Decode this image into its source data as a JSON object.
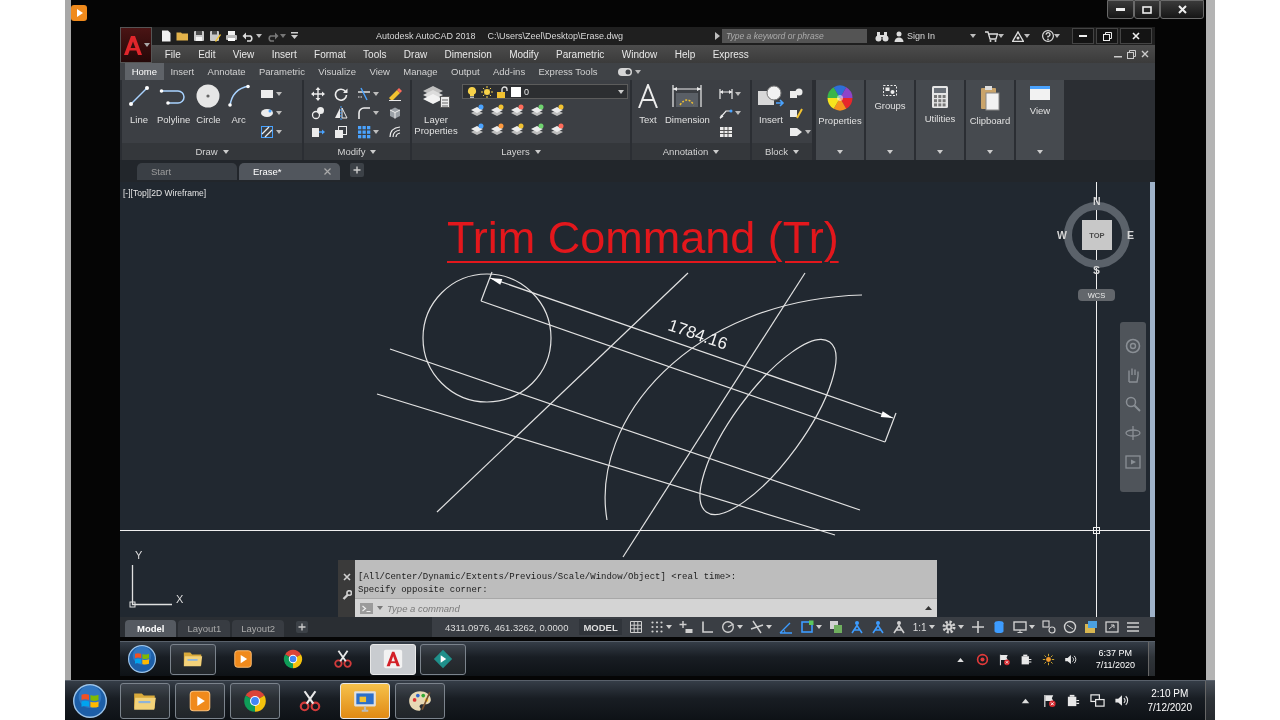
{
  "autocad": {
    "title": {
      "app": "Autodesk AutoCAD 2018",
      "file": "C:\\Users\\Zeel\\Desktop\\Erase.dwg"
    },
    "search": {
      "placeholder": "Type a keyword or phrase"
    },
    "sign_in": "Sign In",
    "menu": [
      "File",
      "Edit",
      "View",
      "Insert",
      "Format",
      "Tools",
      "Draw",
      "Dimension",
      "Modify",
      "Parametric",
      "Window",
      "Help",
      "Express"
    ],
    "ribbon_tabs": [
      {
        "label": "Home",
        "selected": true
      },
      {
        "label": "Insert",
        "selected": false
      },
      {
        "label": "Annotate",
        "selected": false
      },
      {
        "label": "Parametric",
        "selected": false
      },
      {
        "label": "Visualize",
        "selected": false
      },
      {
        "label": "View",
        "selected": false
      },
      {
        "label": "Manage",
        "selected": false
      },
      {
        "label": "Output",
        "selected": false
      },
      {
        "label": "Add-ins",
        "selected": false
      },
      {
        "label": "Express Tools",
        "selected": false
      }
    ],
    "ribbon_panels": [
      {
        "kind": "draw",
        "title": "Draw",
        "tools": [
          "Line",
          "Polyline",
          "Circle",
          "Arc"
        ]
      },
      {
        "kind": "modify",
        "title": "Modify"
      },
      {
        "kind": "layers",
        "title": "Layers",
        "tools": [
          "Layer Properties"
        ],
        "current_layer": "0"
      },
      {
        "kind": "annotation",
        "title": "Annotation",
        "tools": [
          "Text",
          "Dimension"
        ]
      },
      {
        "kind": "block",
        "title": "Block",
        "tools": [
          "Insert"
        ]
      }
    ],
    "ribbon_buttons": [
      "Properties",
      "Groups",
      "Utilities",
      "Clipboard",
      "View"
    ],
    "file_tabs": [
      {
        "label": "Start",
        "selected": false
      },
      {
        "label": "Erase*",
        "selected": true
      }
    ],
    "viewport_controls": "[-][Top][2D Wireframe]",
    "drawing": {
      "title": "Trim Command (Tr)",
      "dimension": "1784.16"
    },
    "viewcube": {
      "face": "TOP",
      "north": "N",
      "east": "E",
      "south": "S",
      "west": "W",
      "ucs_menu": "WCS"
    },
    "ucs_icon": {
      "x": "X",
      "y": "Y"
    },
    "command_line": {
      "history": [
        "[All/Center/Dynamic/Extents/Previous/Scale/Window/Object] <real time>:",
        "Specify opposite corner:"
      ],
      "placeholder": "Type a command"
    },
    "layout_tabs": [
      {
        "label": "Model",
        "selected": true
      },
      {
        "label": "Layout1",
        "selected": false
      },
      {
        "label": "Layout2",
        "selected": false
      }
    ],
    "status_bar": {
      "coordinates": "4311.0976, 461.3262, 0.0000",
      "space": "MODEL",
      "annotation_scale": "1:1",
      "toggles": [
        {
          "on": false
        },
        {
          "on": false
        },
        {
          "on": false
        },
        {
          "on": false
        },
        {
          "on": false
        },
        {
          "on": false
        },
        {
          "on": true
        },
        {
          "on": true
        },
        {
          "on": false
        },
        {
          "on": true
        },
        {
          "on": true
        },
        {
          "on": false
        },
        {
          "on": false
        },
        {
          "on": true
        },
        {
          "on": false
        },
        {
          "on": false
        }
      ]
    }
  },
  "inner_taskbar": {
    "apps": [
      {
        "running": true,
        "selected": false
      },
      {
        "running": false,
        "selected": false
      },
      {
        "running": false,
        "selected": false
      },
      {
        "running": false,
        "selected": false
      },
      {
        "running": true,
        "selected": true
      },
      {
        "running": true,
        "selected": false
      }
    ],
    "time": "6:37 PM",
    "date": "7/11/2020"
  },
  "outer_taskbar": {
    "apps": [
      {
        "running": true,
        "selected": false
      },
      {
        "running": true,
        "selected": false
      },
      {
        "running": true,
        "selected": false
      },
      {
        "running": false,
        "selected": false
      },
      {
        "running": true,
        "selected": true
      },
      {
        "running": true,
        "selected": false
      }
    ],
    "time": "2:10 PM",
    "date": "7/12/2020"
  }
}
